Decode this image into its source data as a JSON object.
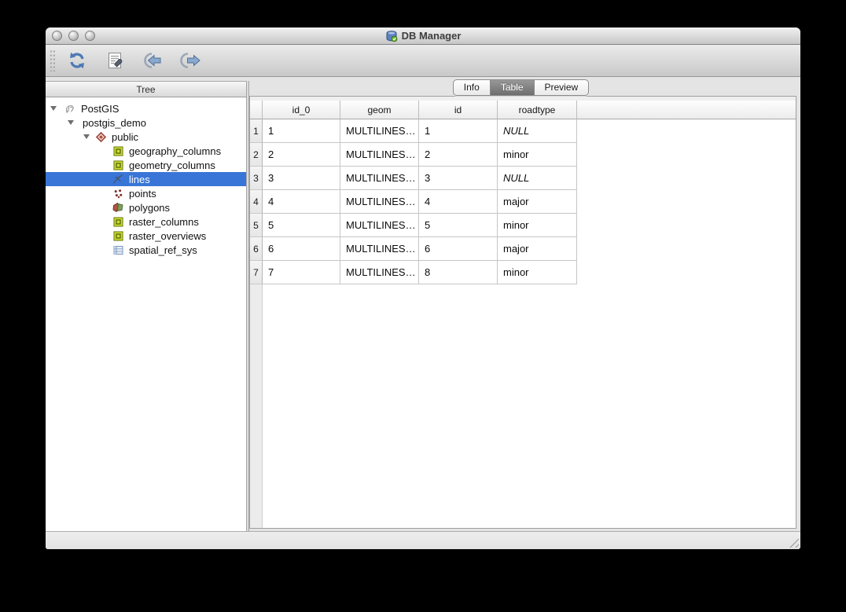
{
  "window": {
    "title": "DB Manager"
  },
  "toolbar": {
    "icons": [
      "refresh-icon",
      "sql-window-icon",
      "import-layer-icon",
      "export-to-file-icon"
    ]
  },
  "sidebar": {
    "header": "Tree",
    "items": [
      {
        "label": "PostGIS",
        "icon": "postgis-elephant-icon",
        "level": 0,
        "expanded": true,
        "selected": false
      },
      {
        "label": "postgis_demo",
        "icon": null,
        "level": 1,
        "expanded": true,
        "selected": false
      },
      {
        "label": "public",
        "icon": "schema-icon",
        "level": 2,
        "expanded": true,
        "selected": false
      },
      {
        "label": "geography_columns",
        "icon": "system-table-icon",
        "level": 3,
        "selected": false
      },
      {
        "label": "geometry_columns",
        "icon": "system-table-icon",
        "level": 3,
        "selected": false
      },
      {
        "label": "lines",
        "icon": "line-layer-icon",
        "level": 3,
        "selected": true
      },
      {
        "label": "points",
        "icon": "point-layer-icon",
        "level": 3,
        "selected": false
      },
      {
        "label": "polygons",
        "icon": "polygon-layer-icon",
        "level": 3,
        "selected": false
      },
      {
        "label": "raster_columns",
        "icon": "system-table-icon",
        "level": 3,
        "selected": false
      },
      {
        "label": "raster_overviews",
        "icon": "system-table-icon",
        "level": 3,
        "selected": false
      },
      {
        "label": "spatial_ref_sys",
        "icon": "table-icon",
        "level": 3,
        "selected": false
      }
    ]
  },
  "tabs": {
    "items": [
      {
        "label": "Info",
        "selected": false
      },
      {
        "label": "Table",
        "selected": true
      },
      {
        "label": "Preview",
        "selected": false
      }
    ]
  },
  "table": {
    "columns": [
      "id_0",
      "geom",
      "id",
      "roadtype"
    ],
    "rows": [
      {
        "num": "1",
        "id_0": "1",
        "geom": "MULTILINES…",
        "id": "1",
        "roadtype": "NULL",
        "roadtype_is_null": true
      },
      {
        "num": "2",
        "id_0": "2",
        "geom": "MULTILINES…",
        "id": "2",
        "roadtype": "minor",
        "roadtype_is_null": false
      },
      {
        "num": "3",
        "id_0": "3",
        "geom": "MULTILINES…",
        "id": "3",
        "roadtype": "NULL",
        "roadtype_is_null": true
      },
      {
        "num": "4",
        "id_0": "4",
        "geom": "MULTILINES…",
        "id": "4",
        "roadtype": "major",
        "roadtype_is_null": false
      },
      {
        "num": "5",
        "id_0": "5",
        "geom": "MULTILINES…",
        "id": "5",
        "roadtype": "minor",
        "roadtype_is_null": false
      },
      {
        "num": "6",
        "id_0": "6",
        "geom": "MULTILINES…",
        "id": "6",
        "roadtype": "major",
        "roadtype_is_null": false
      },
      {
        "num": "7",
        "id_0": "7",
        "geom": "MULTILINES…",
        "id": "8",
        "roadtype": "minor",
        "roadtype_is_null": false
      }
    ]
  },
  "colors": {
    "selection": "#3875d7",
    "tab_selected": "#787878",
    "chrome": "#d9d9d9"
  }
}
